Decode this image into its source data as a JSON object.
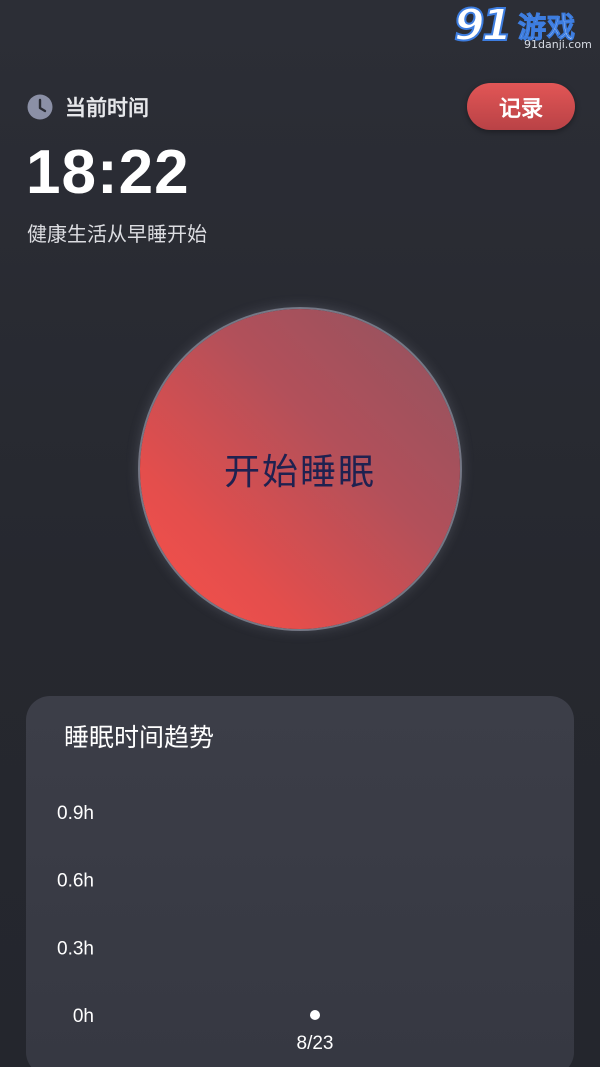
{
  "watermark": {
    "logo": "91",
    "name": "游戏",
    "url": "91danji.com"
  },
  "header": {
    "time_label": "当前时间",
    "record_label": "记录",
    "current_time": "18:22",
    "slogan": "健康生活从早睡开始"
  },
  "main": {
    "start_label": "开始睡眠"
  },
  "colors": {
    "accent": "#e25656",
    "circle_start": "#f8514a",
    "circle_end": "#8f5360",
    "background": "#2a2c34",
    "card": "#3a3c46"
  },
  "chart_data": {
    "type": "line",
    "title": "睡眠时间趋势",
    "y_ticks": [
      "0.9h",
      "0.6h",
      "0.3h",
      "0h"
    ],
    "y_tick_values": [
      0.9,
      0.6,
      0.3,
      0
    ],
    "ylim": [
      0,
      0.9
    ],
    "categories": [
      "8/23"
    ],
    "values": [
      0
    ],
    "grid": false,
    "legend": "none"
  }
}
